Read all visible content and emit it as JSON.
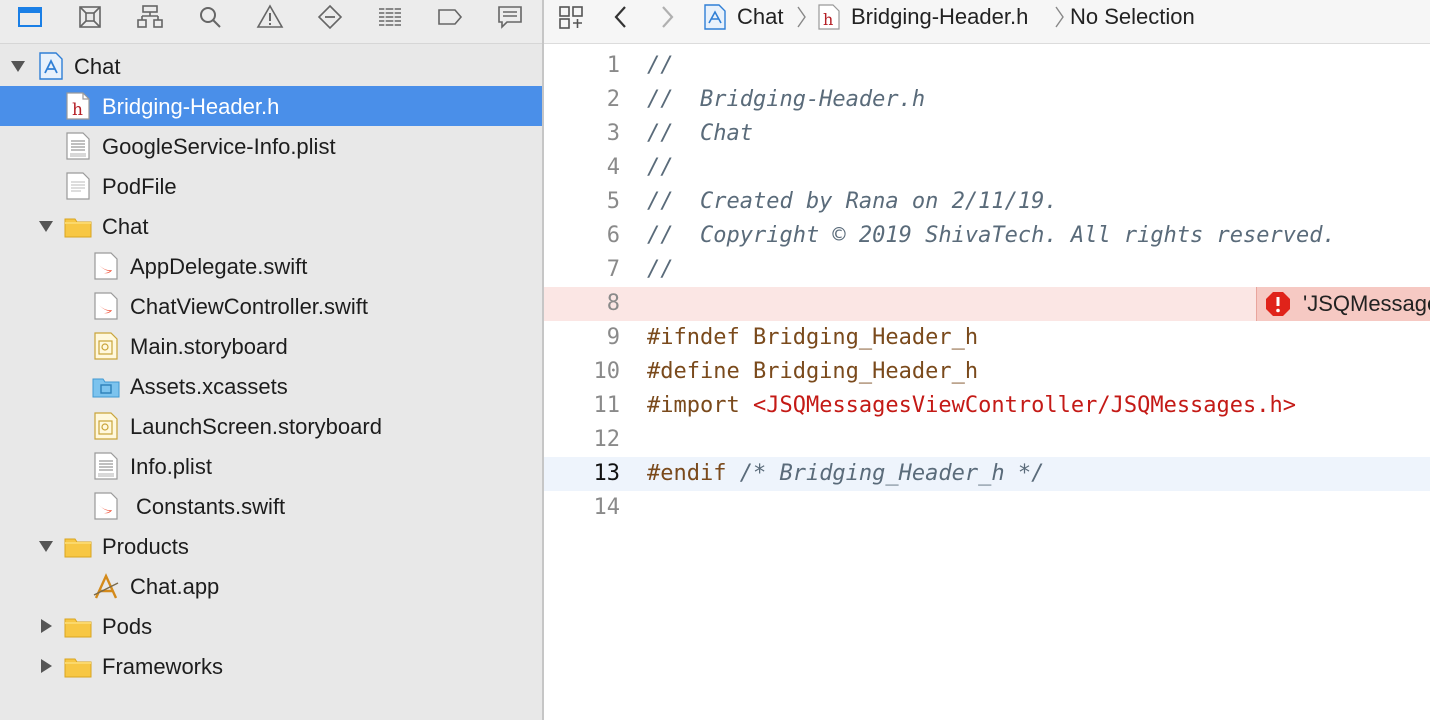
{
  "navigator": {
    "toolbar": [
      {
        "name": "project-navigator-icon",
        "active": true
      },
      {
        "name": "source-control-navigator-icon"
      },
      {
        "name": "symbol-navigator-icon"
      },
      {
        "name": "find-navigator-icon"
      },
      {
        "name": "issue-navigator-icon"
      },
      {
        "name": "test-navigator-icon"
      },
      {
        "name": "debug-navigator-icon"
      },
      {
        "name": "breakpoint-navigator-icon"
      },
      {
        "name": "report-navigator-icon"
      }
    ],
    "items": [
      {
        "label": "Chat",
        "icon": "project-icon",
        "disclosure": "open",
        "indent": 0
      },
      {
        "label": "Bridging-Header.h",
        "icon": "header-file-icon",
        "indent": 1,
        "selected": true
      },
      {
        "label": "GoogleService-Info.plist",
        "icon": "plist-file-icon",
        "indent": 1
      },
      {
        "label": "PodFile",
        "icon": "text-file-icon",
        "indent": 1
      },
      {
        "label": "Chat",
        "icon": "folder-icon",
        "disclosure": "open",
        "indent": 1
      },
      {
        "label": "AppDelegate.swift",
        "icon": "swift-file-icon",
        "indent": 2
      },
      {
        "label": "ChatViewController.swift",
        "icon": "swift-file-icon",
        "indent": 2
      },
      {
        "label": "Main.storyboard",
        "icon": "storyboard-file-icon",
        "indent": 2
      },
      {
        "label": "Assets.xcassets",
        "icon": "asset-folder-icon",
        "indent": 2
      },
      {
        "label": "LaunchScreen.storyboard",
        "icon": "storyboard-file-icon",
        "indent": 2
      },
      {
        "label": "Info.plist",
        "icon": "plist-file-icon",
        "indent": 2
      },
      {
        "label": "Constants.swift",
        "icon": "swift-file-icon",
        "indent": 2
      },
      {
        "label": "Products",
        "icon": "folder-icon",
        "disclosure": "open",
        "indent": 1
      },
      {
        "label": "Chat.app",
        "icon": "app-product-icon",
        "indent": 2
      },
      {
        "label": "Pods",
        "icon": "folder-icon",
        "disclosure": "closed",
        "indent": 1
      },
      {
        "label": "Frameworks",
        "icon": "folder-icon",
        "disclosure": "closed",
        "indent": 1
      }
    ]
  },
  "jumpbar": {
    "project": "Chat",
    "file": "Bridging-Header.h",
    "selection": "No Selection"
  },
  "editor": {
    "error_message": "'JSQMessagesViewController/JSQMessages.h' file not found",
    "current_line": 13,
    "error_line": 8,
    "lines": [
      [
        {
          "t": "//",
          "c": "comment"
        }
      ],
      [
        {
          "t": "//  Bridging-Header.h",
          "c": "comment"
        }
      ],
      [
        {
          "t": "//  Chat",
          "c": "comment"
        }
      ],
      [
        {
          "t": "//",
          "c": "comment"
        }
      ],
      [
        {
          "t": "//  Created by Rana on 2/11/19.",
          "c": "comment"
        }
      ],
      [
        {
          "t": "//  Copyright © 2019 ShivaTech. All rights reserved.",
          "c": "comment"
        }
      ],
      [
        {
          "t": "//",
          "c": "comment"
        }
      ],
      [],
      [
        {
          "t": "#ifndef Bridging_Header_h",
          "c": "pre"
        }
      ],
      [
        {
          "t": "#define Bridging_Header_h",
          "c": "pre"
        }
      ],
      [
        {
          "t": "#import ",
          "c": "pre"
        },
        {
          "t": "<JSQMessagesViewController/JSQMessages.h>",
          "c": "str"
        }
      ],
      [],
      [
        {
          "t": "#endif ",
          "c": "pre"
        },
        {
          "t": "/* Bridging_Header_h */",
          "c": "comment"
        }
      ],
      []
    ]
  },
  "colors": {
    "selection": "#4a8fe9",
    "accent": "#1a7fe6",
    "error": "#e0231a",
    "folder": "#f7c744"
  }
}
